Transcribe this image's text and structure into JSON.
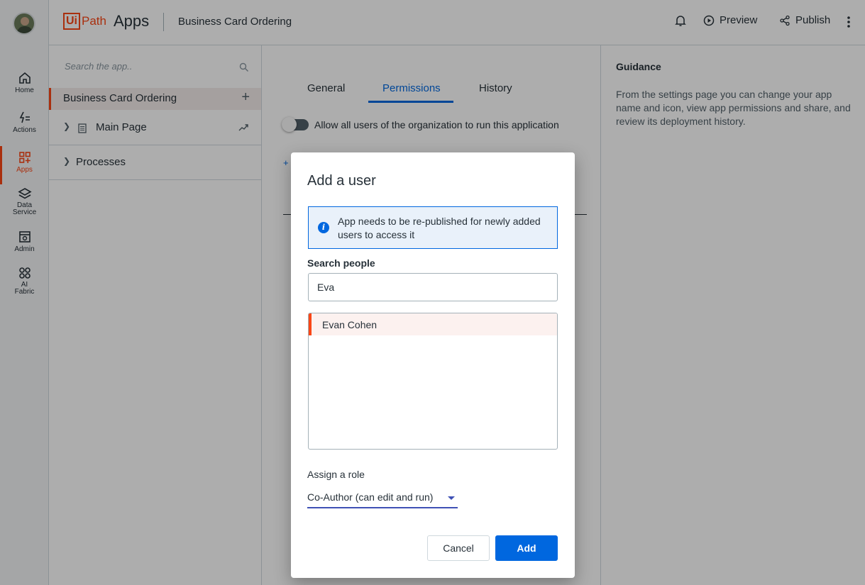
{
  "rail": {
    "items": [
      {
        "label": "Home",
        "icon": "home-icon"
      },
      {
        "label": "Actions",
        "icon": "actions-icon"
      },
      {
        "label": "Apps",
        "icon": "apps-icon"
      },
      {
        "label": "Data Service",
        "icon": "data-service-icon"
      },
      {
        "label": "Admin",
        "icon": "admin-icon"
      },
      {
        "label": "AI Fabric",
        "icon": "ai-fabric-icon"
      }
    ],
    "active": "Apps"
  },
  "topbar": {
    "logo_ui": "Ui",
    "logo_path": "Path",
    "logo_apps": "Apps",
    "app_title": "Business Card Ordering",
    "preview_label": "Preview",
    "publish_label": "Publish"
  },
  "explorer": {
    "search_placeholder": "Search the app..",
    "app_name": "Business Card Ordering",
    "tree": [
      {
        "label": "Main Page"
      },
      {
        "label": "Processes"
      }
    ]
  },
  "settings": {
    "tabs": [
      "General",
      "Permissions",
      "History"
    ],
    "active_tab": "Permissions",
    "toggle_label": "Allow all users of the organization to run this application",
    "toggle_on": false,
    "add_glyph": "+"
  },
  "guidance": {
    "title": "Guidance",
    "text": "From the settings page you can change your app name and icon, view app permissions and share, and review its deployment history."
  },
  "modal": {
    "title": "Add a user",
    "info": "App needs to be re-published for newly added users to access it",
    "search_label": "Search people",
    "search_value": "Eva",
    "results": [
      "Evan Cohen"
    ],
    "role_label": "Assign a role",
    "role_value": "Co-Author (can edit and run)",
    "cancel_label": "Cancel",
    "add_label": "Add"
  },
  "colors": {
    "brand": "#fa4616",
    "accent": "#0067df"
  }
}
